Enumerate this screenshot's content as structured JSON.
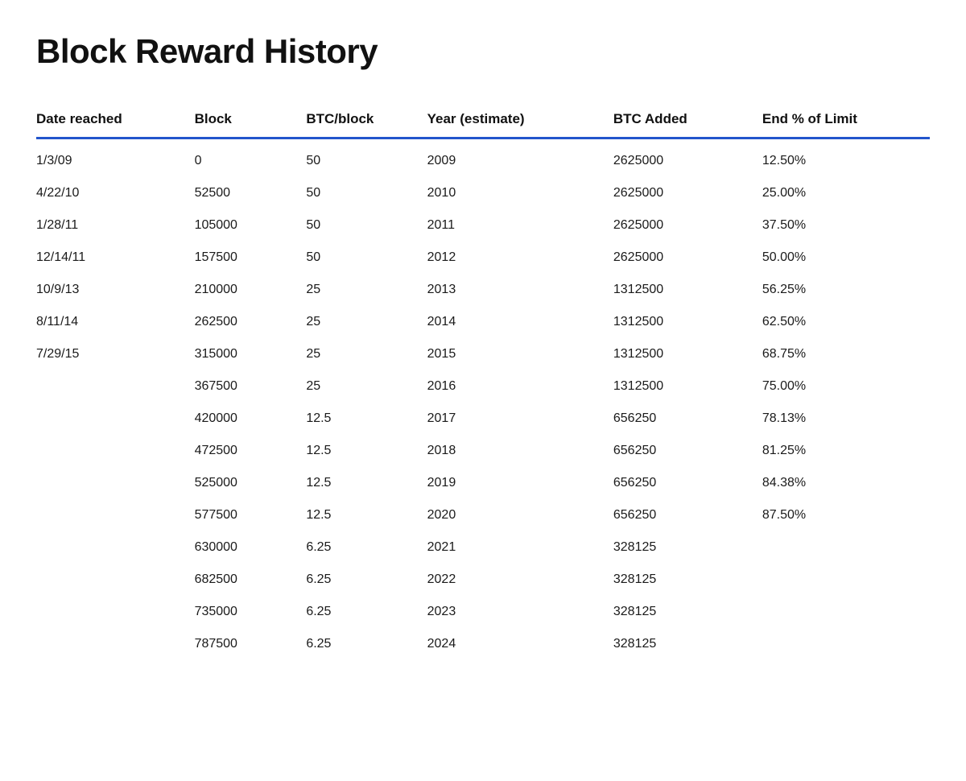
{
  "page": {
    "title": "Block Reward History"
  },
  "table": {
    "headers": [
      "Date reached",
      "Block",
      "BTC/block",
      "Year (estimate)",
      "BTC Added",
      "End % of Limit"
    ],
    "rows": [
      {
        "date": "1/3/09",
        "block": "0",
        "btc_block": "50",
        "year": "2009",
        "btc_added": "2625000",
        "end_pct": "12.50%"
      },
      {
        "date": "4/22/10",
        "block": "52500",
        "btc_block": "50",
        "year": "2010",
        "btc_added": "2625000",
        "end_pct": "25.00%"
      },
      {
        "date": "1/28/11",
        "block": "105000",
        "btc_block": "50",
        "year": "2011",
        "btc_added": "2625000",
        "end_pct": "37.50%"
      },
      {
        "date": "12/14/11",
        "block": "157500",
        "btc_block": "50",
        "year": "2012",
        "btc_added": "2625000",
        "end_pct": "50.00%"
      },
      {
        "date": "10/9/13",
        "block": "210000",
        "btc_block": "25",
        "year": "2013",
        "btc_added": "1312500",
        "end_pct": "56.25%"
      },
      {
        "date": "8/11/14",
        "block": "262500",
        "btc_block": "25",
        "year": "2014",
        "btc_added": "1312500",
        "end_pct": "62.50%"
      },
      {
        "date": "7/29/15",
        "block": "315000",
        "btc_block": "25",
        "year": "2015",
        "btc_added": "1312500",
        "end_pct": "68.75%"
      },
      {
        "date": "",
        "block": "367500",
        "btc_block": "25",
        "year": "2016",
        "btc_added": "1312500",
        "end_pct": "75.00%"
      },
      {
        "date": "",
        "block": "420000",
        "btc_block": "12.5",
        "year": "2017",
        "btc_added": "656250",
        "end_pct": "78.13%"
      },
      {
        "date": "",
        "block": "472500",
        "btc_block": "12.5",
        "year": "2018",
        "btc_added": "656250",
        "end_pct": "81.25%"
      },
      {
        "date": "",
        "block": "525000",
        "btc_block": "12.5",
        "year": "2019",
        "btc_added": "656250",
        "end_pct": "84.38%"
      },
      {
        "date": "",
        "block": "577500",
        "btc_block": "12.5",
        "year": "2020",
        "btc_added": "656250",
        "end_pct": "87.50%"
      },
      {
        "date": "",
        "block": "630000",
        "btc_block": "6.25",
        "year": "2021",
        "btc_added": "328125",
        "end_pct": ""
      },
      {
        "date": "",
        "block": "682500",
        "btc_block": "6.25",
        "year": "2022",
        "btc_added": "328125",
        "end_pct": ""
      },
      {
        "date": "",
        "block": "735000",
        "btc_block": "6.25",
        "year": "2023",
        "btc_added": "328125",
        "end_pct": ""
      },
      {
        "date": "",
        "block": "787500",
        "btc_block": "6.25",
        "year": "2024",
        "btc_added": "328125",
        "end_pct": ""
      }
    ]
  }
}
